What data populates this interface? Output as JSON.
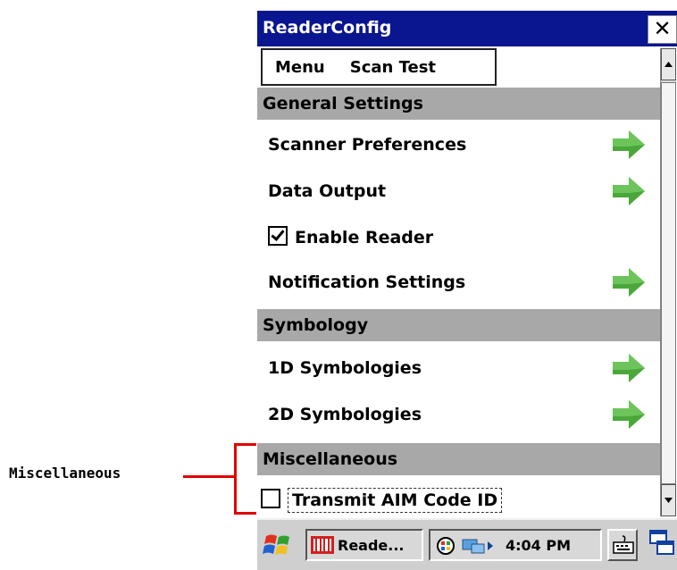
{
  "callout": {
    "label": "Miscellaneous"
  },
  "window": {
    "title": "ReaderConfig",
    "close_glyph": "✕"
  },
  "menu": {
    "items": [
      "Menu",
      "Scan Test"
    ]
  },
  "sections": [
    {
      "header": "General Settings",
      "items": [
        {
          "label": "Scanner Preferences",
          "type": "link"
        },
        {
          "label": "Data Output",
          "type": "link"
        },
        {
          "label": "Enable Reader",
          "type": "checkbox",
          "checked": true
        },
        {
          "label": "Notification Settings",
          "type": "link"
        }
      ]
    },
    {
      "header": "Symbology",
      "items": [
        {
          "label": "1D Symbologies",
          "type": "link"
        },
        {
          "label": "2D Symbologies",
          "type": "link"
        }
      ]
    },
    {
      "header": "Miscellaneous",
      "items": [
        {
          "label": "Transmit AIM Code ID",
          "type": "checkbox",
          "checked": false
        }
      ]
    }
  ],
  "taskbar": {
    "app_button": "Reade...",
    "time": "4:04 PM"
  },
  "colors": {
    "titlebar": "#0a1590",
    "arrow": "#4aa83a",
    "callout": "#e00000",
    "section_bg": "#a8a8a8"
  },
  "icons": [
    "windows-start-icon",
    "app-barcode-icon",
    "network-icon",
    "connection-icon",
    "keyboard-icon",
    "window-switch-icon"
  ]
}
